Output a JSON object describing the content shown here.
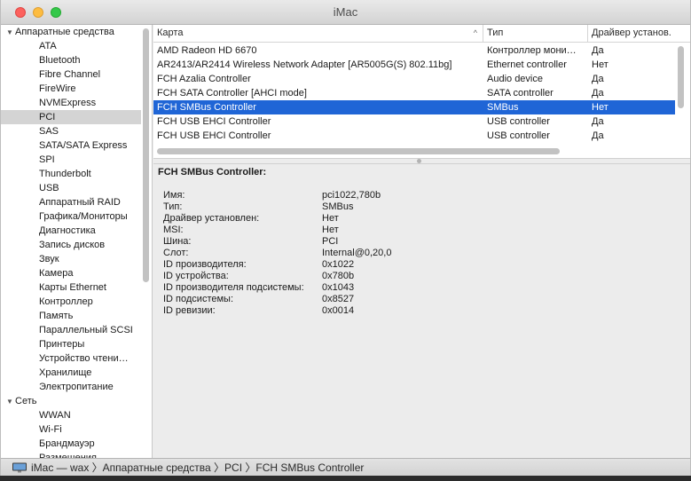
{
  "window": {
    "title": "iMac"
  },
  "sidebar": {
    "hardware": {
      "label": "Аппаратные средства",
      "items": [
        "ATA",
        "Bluetooth",
        "Fibre Channel",
        "FireWire",
        "NVMExpress",
        "PCI",
        "SAS",
        "SATA/SATA Express",
        "SPI",
        "Thunderbolt",
        "USB",
        "Аппаратный RAID",
        "Графика/Мониторы",
        "Диагностика",
        "Запись дисков",
        "Звук",
        "Камера",
        "Карты Ethernet",
        "Контроллер",
        "Память",
        "Параллельный SCSI",
        "Принтеры",
        "Устройство чтени…",
        "Хранилище",
        "Электропитание"
      ],
      "selected": "PCI"
    },
    "network": {
      "label": "Сеть",
      "items": [
        "WWAN",
        "Wi-Fi",
        "Брандмауэр",
        "Размещения"
      ]
    }
  },
  "table": {
    "columns": [
      "Карта",
      "Тип",
      "Драйвер установ."
    ],
    "rows": [
      [
        "AMD Radeon HD 6670",
        "Контроллер мони…",
        "Да"
      ],
      [
        "AR2413/AR2414 Wireless Network Adapter [AR5005G(S) 802.11bg]",
        "Ethernet controller",
        "Нет"
      ],
      [
        "FCH Azalia Controller",
        "Audio device",
        "Да"
      ],
      [
        "FCH SATA Controller [AHCI mode]",
        "SATA controller",
        "Да"
      ],
      [
        "FCH SMBus Controller",
        "SMBus",
        "Нет"
      ],
      [
        "FCH USB EHCI Controller",
        "USB controller",
        "Да"
      ],
      [
        "FCH USB EHCI Controller",
        "USB controller",
        "Да"
      ]
    ],
    "selected_row": 4
  },
  "detail": {
    "title": "FCH SMBus Controller:",
    "fields": [
      [
        "Имя:",
        "pci1022,780b"
      ],
      [
        "Тип:",
        "SMBus"
      ],
      [
        "Драйвер установлен:",
        "Нет"
      ],
      [
        "MSI:",
        "Нет"
      ],
      [
        "Шина:",
        "PCI"
      ],
      [
        "Слот:",
        "Internal@0,20,0"
      ],
      [
        "ID производителя:",
        "0x1022"
      ],
      [
        "ID устройства:",
        "0x780b"
      ],
      [
        "ID производителя подсистемы:",
        "0x1043"
      ],
      [
        "ID подсистемы:",
        "0x8527"
      ],
      [
        "ID ревизии:",
        "0x0014"
      ]
    ]
  },
  "statusbar": {
    "path": "iMac — wax 〉Аппаратные средства 〉PCI 〉FCH SMBus Controller"
  },
  "colors": {
    "selection": "#1f65d6",
    "sidebar_selection": "#d4d4d4"
  }
}
